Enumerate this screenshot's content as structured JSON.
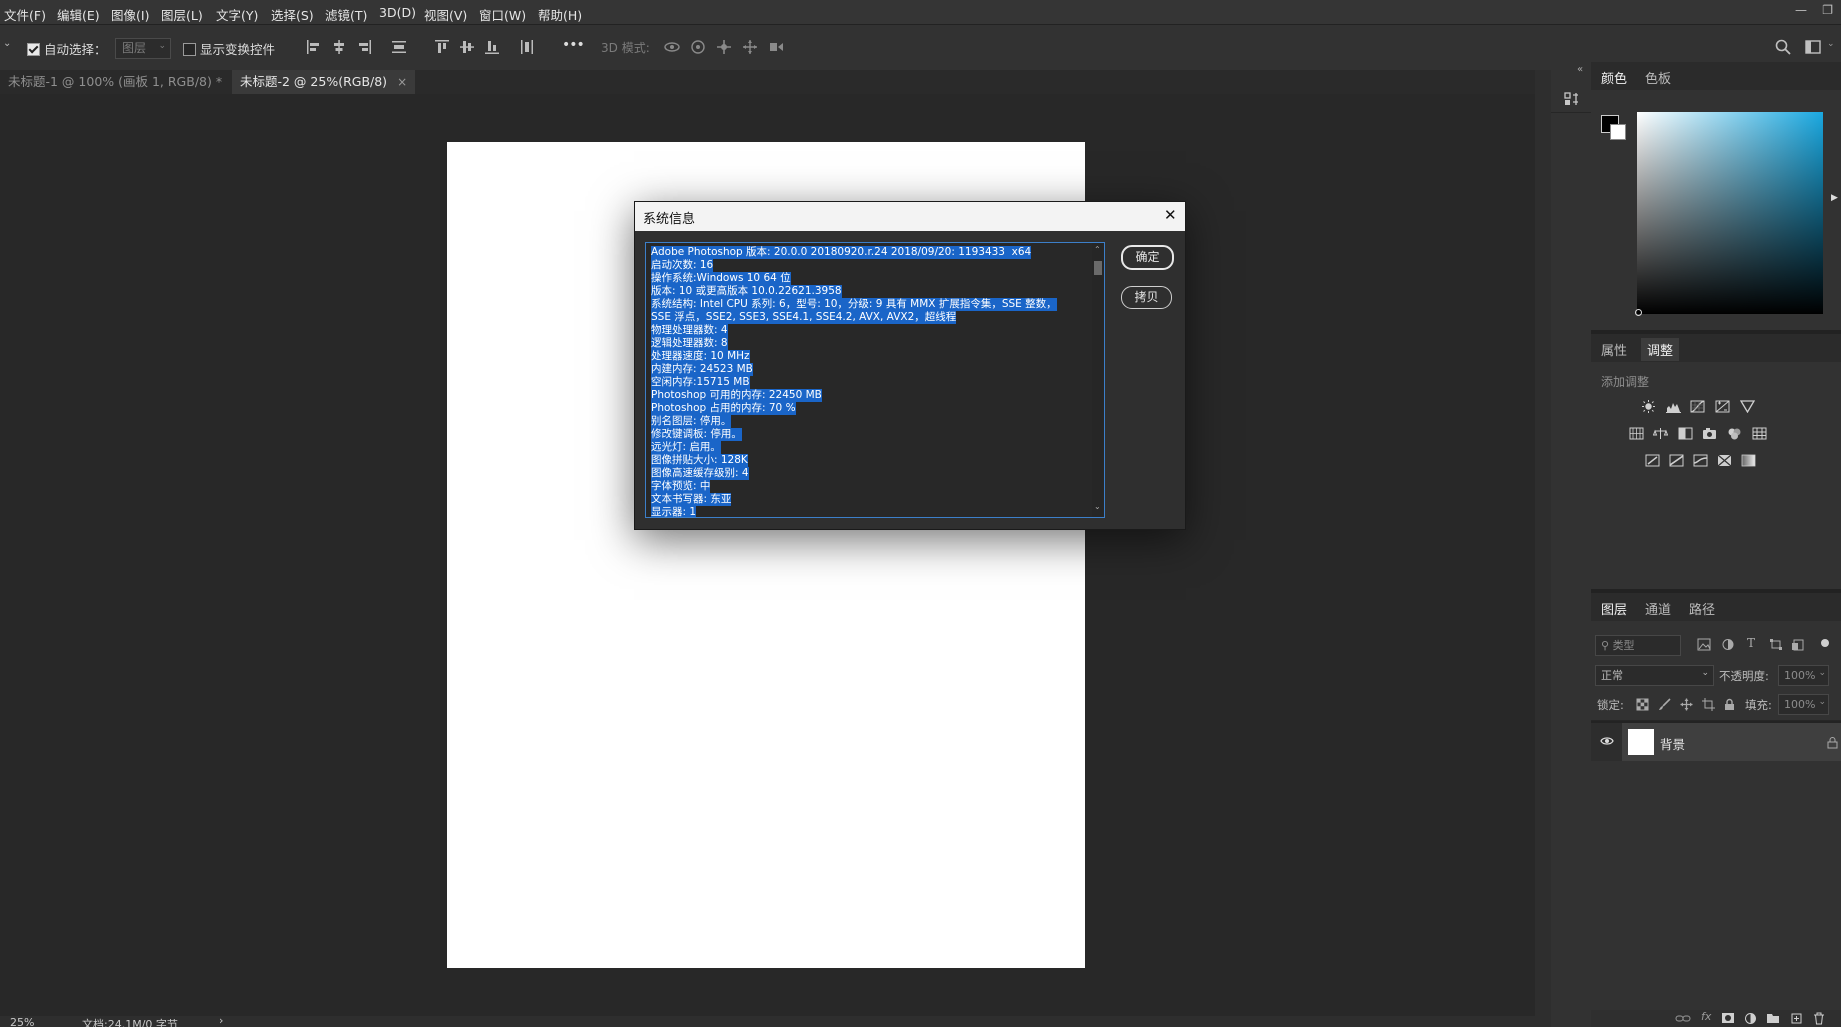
{
  "menus": [
    "文件(F)",
    "编辑(E)",
    "图像(I)",
    "图层(L)",
    "文字(Y)",
    "选择(S)",
    "滤镜(T)",
    "3D(D)",
    "视图(V)",
    "窗口(W)",
    "帮助(H)"
  ],
  "options": {
    "auto_select_label": "自动选择：",
    "auto_select_target": "图层",
    "show_transform_label": "显示变换控件",
    "mode_3d_label": "3D 模式:",
    "more_label": "•••",
    "auto_select_checked": true,
    "show_transform_checked": false
  },
  "tabs": [
    {
      "label": "未标题-1 @ 100% (画板 1, RGB/8) *",
      "active": false
    },
    {
      "label": "未标题-2 @ 25%(RGB/8)",
      "active": true
    }
  ],
  "tab_close": "×",
  "status": {
    "zoom": "25%",
    "doc": "文档:24.1M/0 字节",
    "arrow": "›"
  },
  "dialog": {
    "title": "系统信息",
    "close": "✕",
    "ok": "确定",
    "copy": "拷贝",
    "lines": [
      "Adobe Photoshop 版本: 20.0.0 20180920.r.24 2018/09/20: 1193433  x64",
      "启动次数: 16",
      "操作系统:Windows 10 64 位",
      "版本: 10 或更高版本 10.0.22621.3958",
      "系统结构: Intel CPU 系列: 6，型号: 10，分级: 9 具有 MMX 扩展指令集，SSE 整数，",
      "SSE 浮点，SSE2, SSE3, SSE4.1, SSE4.2, AVX, AVX2，超线程",
      "物理处理器数: 4",
      "逻辑处理器数: 8",
      "处理器速度: 10 MHz",
      "内建内存: 24523 MB",
      "空闲内存:15715 MB",
      "Photoshop 可用的内存: 22450 MB",
      "Photoshop 占用的内存: 70 %",
      "别名图层: 停用。",
      "修改键调板: 停用。",
      "远光灯: 启用。",
      "图像拼贴大小: 128K",
      "图像高速缓存级别: 4",
      "字体预览: 中",
      "文本书写器: 东亚",
      "显示器: 1"
    ]
  },
  "color_panel": {
    "tabs": [
      "颜色",
      "色板"
    ],
    "active": "颜色",
    "hue": "#1aa8e0"
  },
  "adjust_panel": {
    "tabs": [
      "属性",
      "调整"
    ],
    "active": "调整",
    "subtitle": "添加调整"
  },
  "layers_panel": {
    "tabs": [
      "图层",
      "通道",
      "路径"
    ],
    "active": "图层",
    "filter_placeholder": "类型",
    "blend_mode": "正常",
    "opacity_label": "不透明度:",
    "opacity_value": "100%",
    "lock_label": "锁定:",
    "fill_label": "填充:",
    "fill_value": "100%",
    "layers": [
      {
        "name": "背景",
        "visible": true,
        "locked": true
      }
    ]
  }
}
